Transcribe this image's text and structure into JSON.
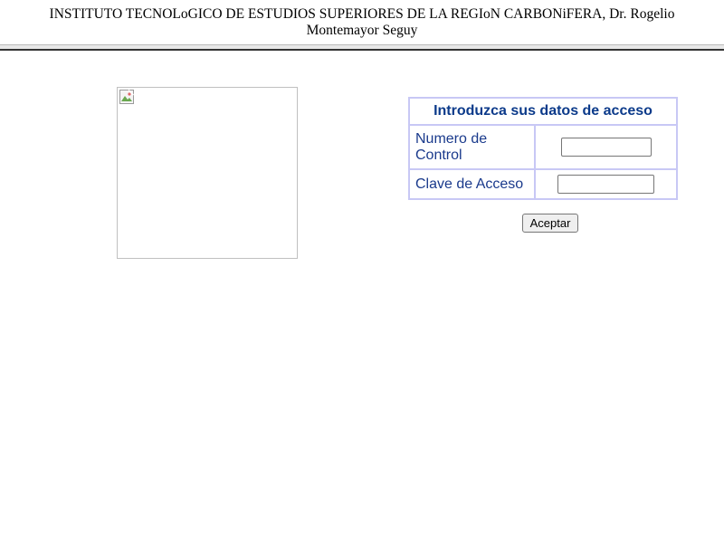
{
  "header": {
    "institution_line_1": "INSTITUTO TECNOLoGICO DE ESTUDIOS SUPERIORES DE LA REGIoN CARBONiFERA, Dr. Rogelio",
    "institution_line_2": "Montemayor Seguy"
  },
  "logo": {
    "icon": "broken-image-icon"
  },
  "login": {
    "title": "Introduzca sus datos de acceso",
    "control_number_label": "Numero de Control",
    "control_number_value": "",
    "password_label": "Clave de Acceso",
    "password_value": "",
    "submit_label": "Aceptar"
  },
  "colors": {
    "title_text": "#0b3a8a",
    "label_text": "#1a3a8c",
    "table_border": "#c8c8f5"
  }
}
